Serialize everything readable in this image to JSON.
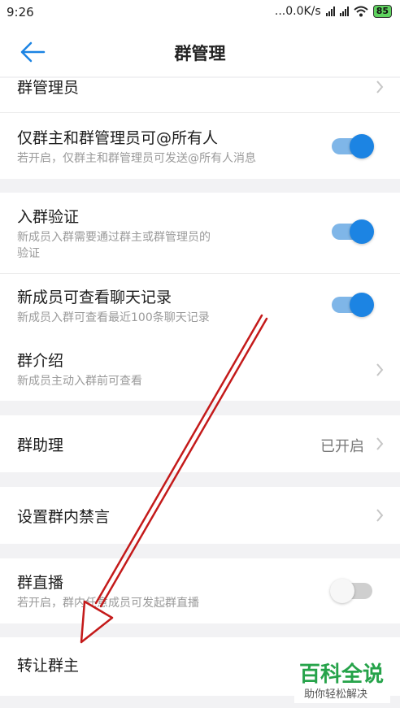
{
  "status_bar": {
    "time": "9:26",
    "network_speed": "...0.0K/s",
    "battery": "85"
  },
  "header": {
    "title": "群管理",
    "back_icon": "back-arrow-icon"
  },
  "rows": {
    "admins": {
      "label": "群管理员"
    },
    "at_all": {
      "label": "仅群主和群管理员可@所有人",
      "desc": "若开启，仅群主和群管理员可发送@所有人消息",
      "enabled": true
    },
    "verify": {
      "label": "入群验证",
      "desc_line1": "新成员入群需要通过群主或群管理员的",
      "desc_line2": "验证",
      "enabled": true
    },
    "history": {
      "label": "新成员可查看聊天记录",
      "desc": "新成员入群可查看最近100条聊天记录",
      "enabled": true
    },
    "intro": {
      "label": "群介绍",
      "desc": "新成员主动入群前可查看"
    },
    "assistant": {
      "label": "群助理",
      "value": "已开启"
    },
    "mute": {
      "label": "设置群内禁言"
    },
    "live": {
      "label": "群直播",
      "desc": "若开启，群内任意成员可发起群直播",
      "enabled": false
    },
    "transfer": {
      "label": "转让群主"
    }
  },
  "watermark": {
    "title": "百科全说",
    "subtitle": "助你轻松解决"
  },
  "colors": {
    "accent": "#1c84e3",
    "annotation_arrow": "#c41a1a",
    "watermark_green": "#26a34a"
  }
}
